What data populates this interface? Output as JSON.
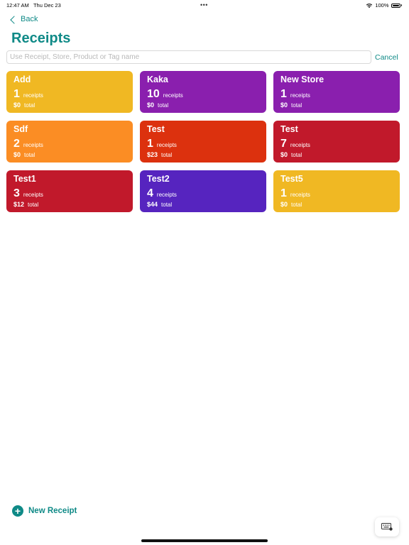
{
  "status_bar": {
    "time": "12:47 AM",
    "date": "Thu Dec 23",
    "battery": "100%",
    "wifi_icon": "wifi-icon"
  },
  "nav": {
    "back_label": "Back"
  },
  "page": {
    "title": "Receipts"
  },
  "search": {
    "placeholder": "Use Receipt, Store, Product or Tag name",
    "value": "",
    "cancel_label": "Cancel"
  },
  "stores": [
    {
      "name": "Add",
      "count": "1",
      "count_label": "receipts",
      "total": "$0",
      "total_label": "total",
      "color": "#f0b823"
    },
    {
      "name": "Kaka",
      "count": "10",
      "count_label": "receipts",
      "total": "$0",
      "total_label": "total",
      "color": "#8a1fae"
    },
    {
      "name": "New Store",
      "count": "1",
      "count_label": "receipts",
      "total": "$0",
      "total_label": "total",
      "color": "#8a1fae"
    },
    {
      "name": "Sdf",
      "count": "2",
      "count_label": "receipts",
      "total": "$0",
      "total_label": "total",
      "color": "#fb8d24"
    },
    {
      "name": "Test",
      "count": "1",
      "count_label": "receipts",
      "total": "$23",
      "total_label": "total",
      "color": "#dc310e"
    },
    {
      "name": "Test",
      "count": "7",
      "count_label": "receipts",
      "total": "$0",
      "total_label": "total",
      "color": "#c1192b"
    },
    {
      "name": "Test1",
      "count": "3",
      "count_label": "receipts",
      "total": "$12",
      "total_label": "total",
      "color": "#c1192b"
    },
    {
      "name": "Test2",
      "count": "4",
      "count_label": "receipts",
      "total": "$44",
      "total_label": "total",
      "color": "#5624bf"
    },
    {
      "name": "Test5",
      "count": "1",
      "count_label": "receipts",
      "total": "$0",
      "total_label": "total",
      "color": "#f0b823"
    }
  ],
  "footer": {
    "new_receipt_label": "New Receipt",
    "plus_icon": "plus-circle-icon",
    "keyboard_icon": "keyboard-icon"
  },
  "accent_color": "#0f8a87"
}
